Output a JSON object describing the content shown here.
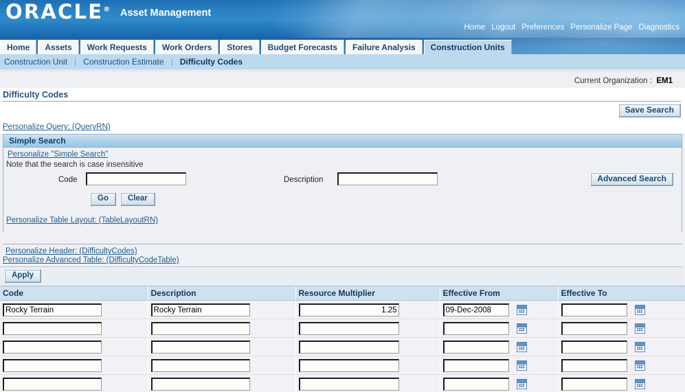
{
  "brand": {
    "logo": "ORACLE",
    "logo_mark": "®",
    "app_title": "Asset Management",
    "global_links": [
      {
        "label": "Home"
      },
      {
        "label": "Logout"
      },
      {
        "label": "Preferences"
      },
      {
        "label": "Personalize Page"
      },
      {
        "label": "Diagnostics"
      }
    ]
  },
  "tabs": [
    {
      "label": "Home",
      "selected": false
    },
    {
      "label": "Assets",
      "selected": false
    },
    {
      "label": "Work Requests",
      "selected": false
    },
    {
      "label": "Work Orders",
      "selected": false
    },
    {
      "label": "Stores",
      "selected": false
    },
    {
      "label": "Budget Forecasts",
      "selected": false
    },
    {
      "label": "Failure Analysis",
      "selected": false
    },
    {
      "label": "Construction Units",
      "selected": true
    }
  ],
  "subtabs": [
    {
      "label": "Construction Unit",
      "current": false
    },
    {
      "label": "Construction Estimate",
      "current": false
    },
    {
      "label": "Difficulty Codes",
      "current": true
    }
  ],
  "org": {
    "label": "Current Organization :",
    "value": "EM1"
  },
  "page": {
    "title": "Difficulty Codes",
    "save_search_label": "Save Search",
    "personalize_query_link": "Personalize Query: (QueryRN)",
    "personalize_header_link": "Personalize Header: (DifficultyCodes)",
    "personalize_advanced_table_link": "Personalize Advanced Table: (DifficultyCodeTable)",
    "apply_label": "Apply"
  },
  "search": {
    "panel_title": "Simple Search",
    "personalize_link": "Personalize \"Simple Search\"",
    "note": "Note that the search is case insensitive",
    "advanced_search_label": "Advanced Search",
    "code_label": "Code",
    "code_value": "",
    "description_label": "Description",
    "description_value": "",
    "go_label": "Go",
    "clear_label": "Clear",
    "personalize_table_layout_link": "Personalize Table Layout: (TableLayoutRN)"
  },
  "table": {
    "columns": [
      {
        "label": "Code"
      },
      {
        "label": "Description"
      },
      {
        "label": "Resource Multiplier"
      },
      {
        "label": "Effective From"
      },
      {
        "label": "Effective To"
      }
    ],
    "rows": [
      {
        "code": "Rocky Terrain",
        "description": "Rocky Terrain",
        "resource_multiplier": "1.25",
        "effective_from": "09-Dec-2008",
        "effective_to": ""
      },
      {
        "code": "",
        "description": "",
        "resource_multiplier": "",
        "effective_from": "",
        "effective_to": ""
      },
      {
        "code": "",
        "description": "",
        "resource_multiplier": "",
        "effective_from": "",
        "effective_to": ""
      },
      {
        "code": "",
        "description": "",
        "resource_multiplier": "",
        "effective_from": "",
        "effective_to": ""
      },
      {
        "code": "",
        "description": "",
        "resource_multiplier": "",
        "effective_from": "",
        "effective_to": ""
      }
    ],
    "calendar_icon_name": "calendar-picker-icon"
  },
  "colors": {
    "brand_blue": "#2379bd",
    "subtab_blue": "#bcd9ee",
    "panel_header": "#9cc6e2",
    "link": "#1f5c8c",
    "page_bg": "#eef0f4"
  }
}
